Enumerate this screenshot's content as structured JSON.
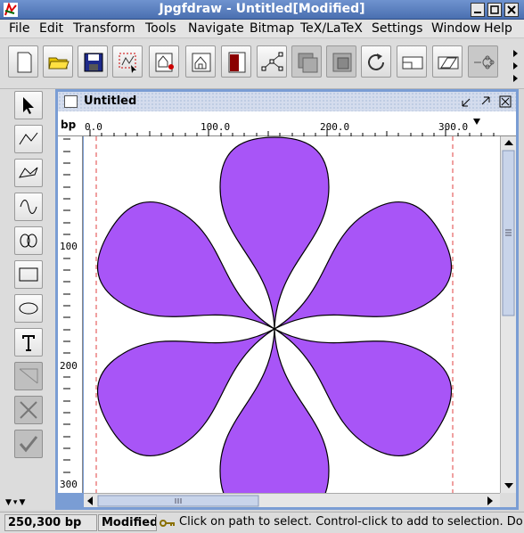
{
  "window": {
    "title": "Jpgfdraw - Untitled[Modified]"
  },
  "menu": [
    "File",
    "Edit",
    "Transform",
    "Tools",
    "Navigate",
    "Bitmap",
    "TeX/LaTeX",
    "Settings",
    "Window",
    "Help"
  ],
  "toolbar": {
    "buttons": [
      "new-file",
      "open-folder",
      "save",
      "select-all",
      "group",
      "ungroup",
      "bitmap",
      "edit-path",
      "move-to-front",
      "move-to-back",
      "rotate",
      "scale",
      "shear",
      "distort"
    ]
  },
  "palette": {
    "tools": [
      "select",
      "open-line",
      "closed-line",
      "open-curve",
      "closed-curve",
      "rectangle",
      "ellipse",
      "text",
      "math",
      "abandon",
      "finish"
    ]
  },
  "document": {
    "title": "Untitled",
    "ruler_unit": "bp",
    "top_ruler_labels": [
      "0.0",
      "100.0",
      "200.0",
      "300.0"
    ],
    "left_ruler_labels": [
      "100",
      "200",
      "300"
    ]
  },
  "figure": {
    "fill_color": "#a855f7",
    "stroke_color": "#000000",
    "petal_count": 6
  },
  "status": {
    "coords": "250,300 bp",
    "modified": "Modified",
    "message": "Click on path to select. Control-click to add to selection. Double"
  }
}
